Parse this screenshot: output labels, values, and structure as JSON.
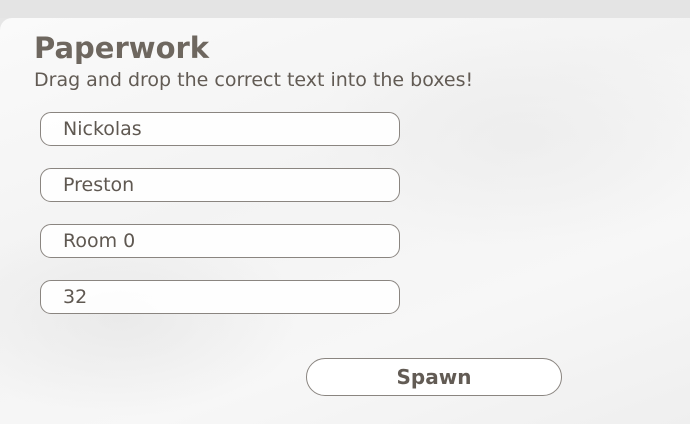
{
  "panel": {
    "title": "Paperwork",
    "subtitle": "Drag and drop the correct text into the boxes!"
  },
  "fields": [
    {
      "value": "Nickolas"
    },
    {
      "value": "Preston"
    },
    {
      "value": "Room 0"
    },
    {
      "value": "32"
    }
  ],
  "actions": {
    "spawn_label": "Spawn"
  },
  "colors": {
    "text": "#6e675f",
    "border": "#8a8580",
    "panel_background": "#f5f5f5"
  }
}
